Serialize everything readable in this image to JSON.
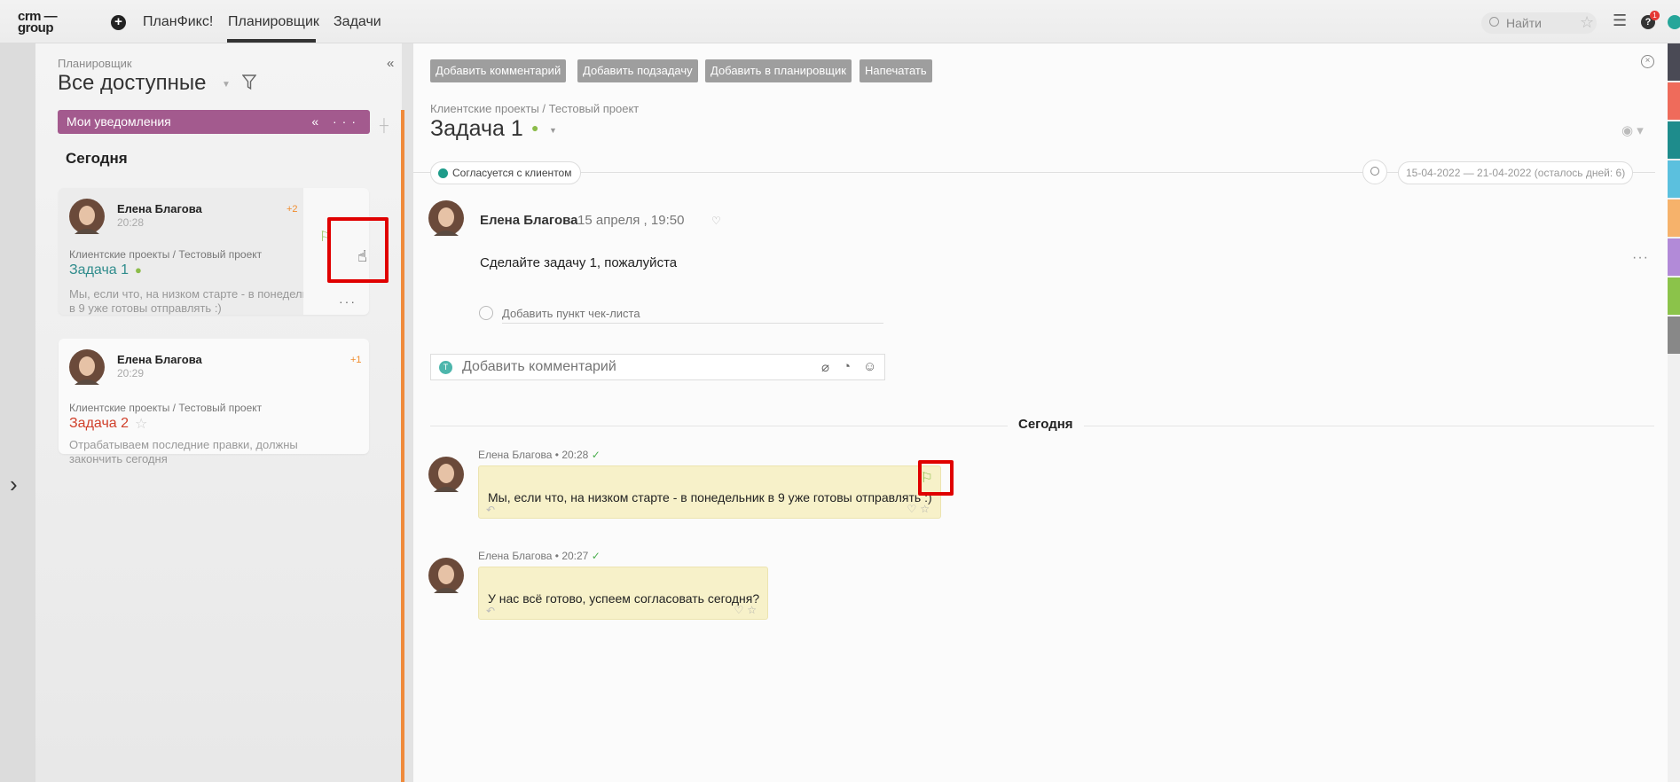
{
  "topbar": {
    "logo": "crm —\ngroup",
    "nav": [
      "ПланФикс!",
      "Планировщик",
      "Задачи"
    ],
    "active_nav": "Планировщик",
    "search_placeholder": "Найти",
    "notification_count": "1"
  },
  "left_panel": {
    "breadcrumb": "Планировщик",
    "title": "Все доступные",
    "notif_bar_label": "Мои уведомления",
    "today_header": "Сегодня",
    "cards": [
      {
        "author": "Елена Благова",
        "time": "20:28",
        "badge": "+2",
        "project": "Клиентские проекты / Тестовый проект",
        "task": "Задача 1",
        "task_color": "#2f8c8c",
        "text": "Мы, если что, на низком старте - в понедельник в 9 уже готовы отправлять :)"
      },
      {
        "author": "Елена Благова",
        "time": "20:29",
        "badge": "+1",
        "project": "Клиентские проекты / Тестовый проект",
        "task": "Задача 2",
        "task_color": "#d0402b",
        "text": "Отрабатываем последние правки, должны закончить сегодня"
      }
    ]
  },
  "main": {
    "buttons": [
      "Добавить комментарий",
      "Добавить подзадачу",
      "Добавить в планировщик",
      "Напечатать"
    ],
    "breadcrumb": "Клиентские проекты / Тестовый проект",
    "title": "Задача 1",
    "status": "Согласуется с клиентом",
    "status_color": "#1e9c8a",
    "date_range": "15-04-2022 — 21-04-2022 (осталось дней: 6)",
    "description": {
      "author": "Елена Благова",
      "date": "15 апреля , 19:50",
      "text": "Сделайте задачу 1, пожалуйста"
    },
    "checklist_placeholder": "Добавить пункт чек-листа",
    "comment_placeholder": "Добавить комментарий",
    "comment_avatar_letter": "T",
    "today_label": "Сегодня",
    "messages": [
      {
        "author": "Елена Благова",
        "time": "20:28",
        "text": "Мы, если что, на низком старте - в понедельник в 9 уже готовы отправлять :)"
      },
      {
        "author": "Елена Благова",
        "time": "20:27",
        "text": "У нас всё готово, успеем согласовать сегодня?"
      }
    ]
  },
  "colors": {
    "accent_orange": "#ef8a3b",
    "notif_bar": "#a35a8e",
    "highlight_red": "#e00000",
    "message_bubble": "#f7f1c9"
  },
  "icons": [
    "add-icon",
    "filter-icon",
    "collapse-icon",
    "flag-icon",
    "cursor-hand-icon",
    "more-icon",
    "close-icon",
    "eye-icon",
    "search-icon",
    "heart-icon",
    "star-icon",
    "reply-icon",
    "attach-icon",
    "bell-icon",
    "emoji-icon",
    "menu-icon",
    "help-icon",
    "chevron-right-icon"
  ]
}
